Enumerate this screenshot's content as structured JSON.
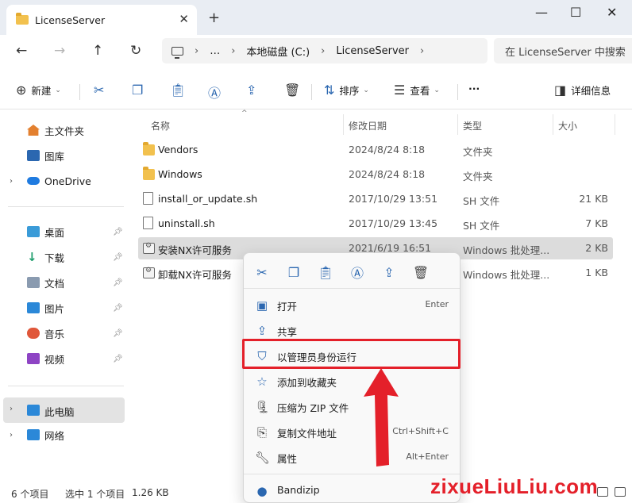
{
  "window": {
    "tab_title": "LicenseServer",
    "tab_close": "✕",
    "new_tab": "+",
    "minimize": "—",
    "maximize": "☐",
    "close": "✕"
  },
  "nav": {
    "back": "←",
    "forward": "→",
    "up": "↑",
    "refresh": "↻",
    "crumb_more": "…",
    "breadcrumbs": [
      "本地磁盘 (C:)",
      "LicenseServer"
    ],
    "search_placeholder": "在 LicenseServer 中搜索"
  },
  "toolbar": {
    "new_label": "新建",
    "sort_label": "排序",
    "view_label": "查看",
    "more_label": "···",
    "details_label": "详细信息"
  },
  "sidebar": {
    "home": "主文件夹",
    "gallery": "图库",
    "onedrive": "OneDrive",
    "desktop": "桌面",
    "downloads": "下载",
    "documents": "文档",
    "pictures": "图片",
    "music": "音乐",
    "videos": "视频",
    "thispc": "此电脑",
    "network": "网络"
  },
  "columns": {
    "name": "名称",
    "modified": "修改日期",
    "type": "类型",
    "size": "大小"
  },
  "files": [
    {
      "name": "Vendors",
      "date": "2024/8/24 8:18",
      "type": "文件夹",
      "size": ""
    },
    {
      "name": "Windows",
      "date": "2024/8/24 8:18",
      "type": "文件夹",
      "size": ""
    },
    {
      "name": "install_or_update.sh",
      "date": "2017/10/29 13:51",
      "type": "SH 文件",
      "size": "21 KB"
    },
    {
      "name": "uninstall.sh",
      "date": "2017/10/29 13:45",
      "type": "SH 文件",
      "size": "7 KB"
    },
    {
      "name": "安装NX许可服务",
      "date": "2021/6/19 16:51",
      "type": "Windows 批处理...",
      "size": "2 KB"
    },
    {
      "name": "卸载NX许可服务",
      "date": "",
      "type": "Windows 批处理...",
      "size": "1 KB"
    }
  ],
  "status": {
    "count": "6 个项目",
    "selected": "选中 1 个项目",
    "size": "1.26 KB"
  },
  "context_menu": {
    "open": "打开",
    "open_key": "Enter",
    "share": "共享",
    "run_as_admin": "以管理员身份运行",
    "add_favorites": "添加到收藏夹",
    "compress_zip": "压缩为 ZIP 文件",
    "copy_path": "复制文件地址",
    "copy_path_key": "Ctrl+Shift+C",
    "properties": "属性",
    "properties_key": "Alt+Enter",
    "bandizip": "Bandizip"
  },
  "watermark": "zixueLiuLiu.com",
  "colors": {
    "accent": "#2b67b0",
    "highlight": "#e4202a",
    "folder": "#f2c14e"
  }
}
